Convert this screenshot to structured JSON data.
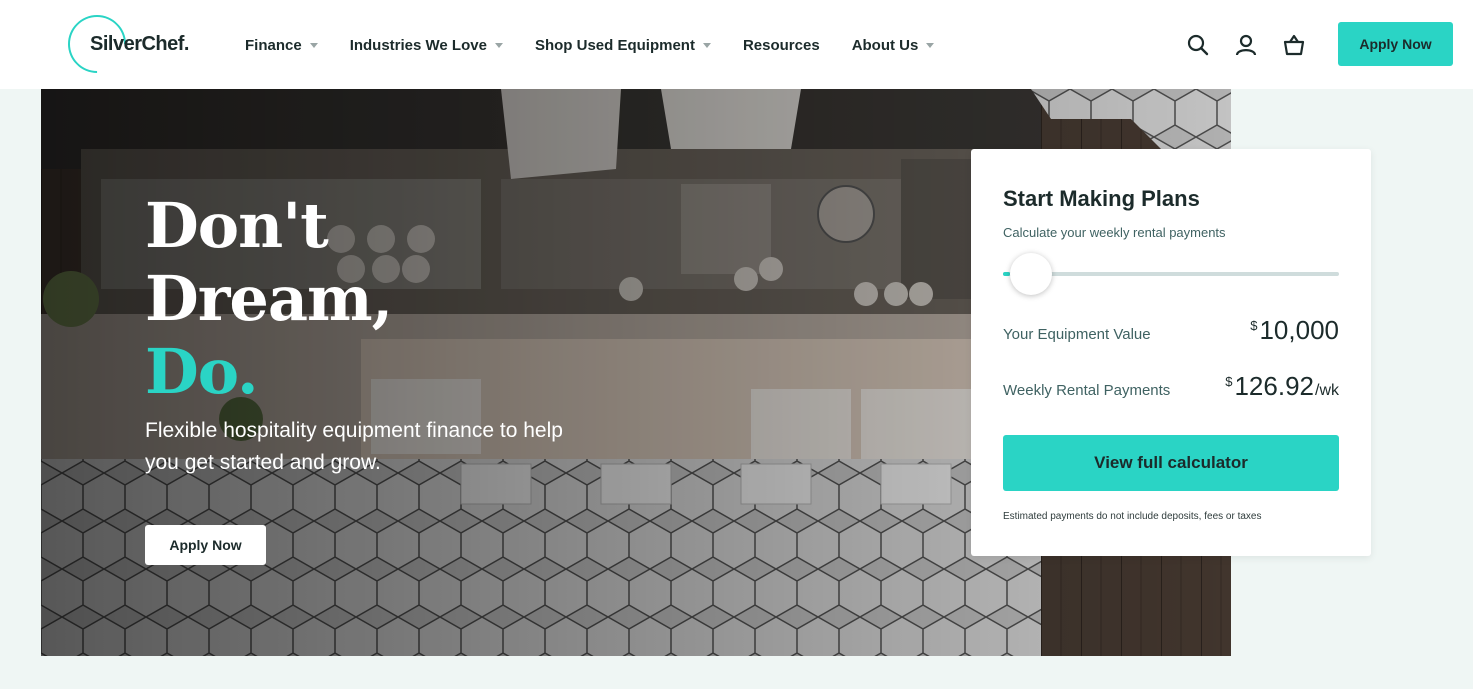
{
  "brand": {
    "name": "SilverChef.",
    "accent_color": "#2ad4c5"
  },
  "nav": {
    "items": [
      {
        "label": "Finance",
        "has_dropdown": true
      },
      {
        "label": "Industries We Love",
        "has_dropdown": true
      },
      {
        "label": "Shop Used Equipment",
        "has_dropdown": true
      },
      {
        "label": "Resources",
        "has_dropdown": false
      },
      {
        "label": "About Us",
        "has_dropdown": true
      }
    ],
    "icons": [
      "search-icon",
      "user-icon",
      "basket-icon"
    ],
    "apply_label": "Apply Now"
  },
  "hero": {
    "headline_line1": "Don't",
    "headline_line2": "Dream,",
    "headline_line3": "Do.",
    "subtext": "Flexible hospitality equipment finance to help you get started and grow.",
    "apply_label": "Apply Now"
  },
  "calculator": {
    "title": "Start Making Plans",
    "subtitle": "Calculate your weekly rental payments",
    "slider_fraction": 0.02,
    "equipment_label": "Your Equipment Value",
    "currency_symbol": "$",
    "equipment_value": "10,000",
    "weekly_label": "Weekly Rental Payments",
    "weekly_value": "126.92",
    "weekly_unit": "/wk",
    "button_label": "View full calculator",
    "disclaimer": "Estimated payments do not include deposits, fees or taxes"
  }
}
